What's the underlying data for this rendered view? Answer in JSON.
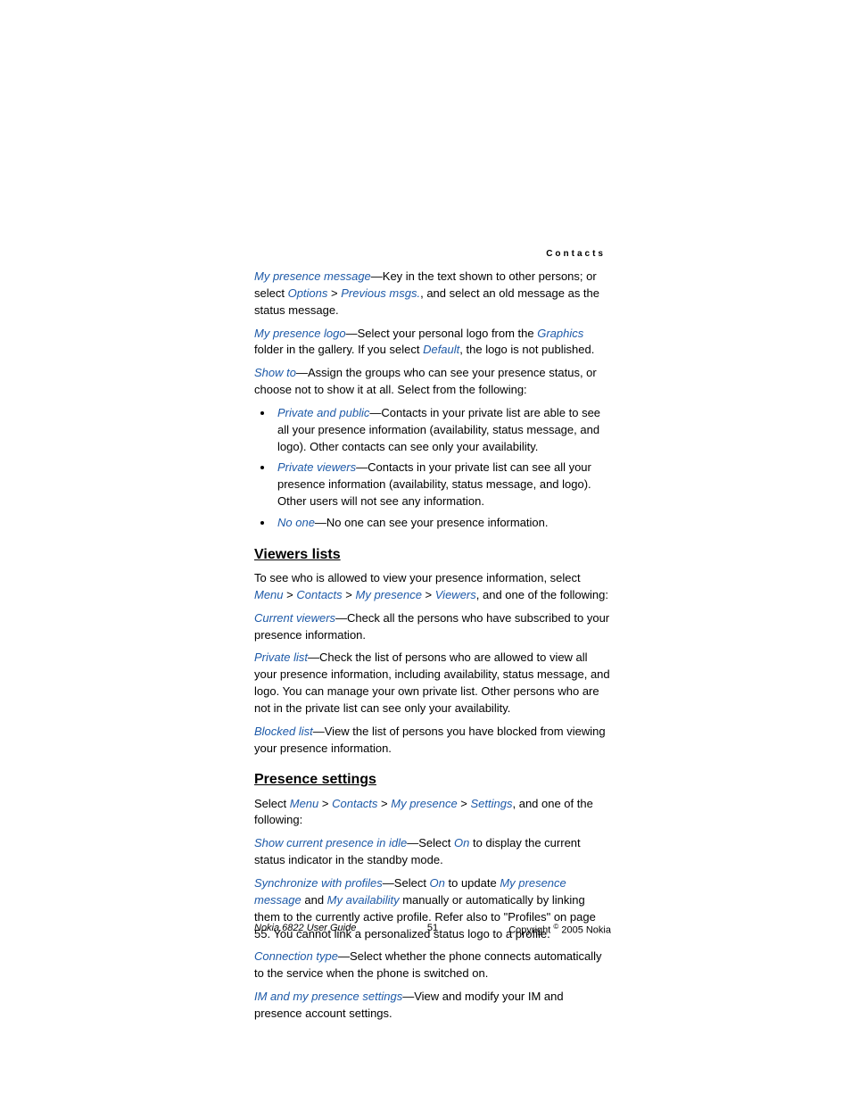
{
  "header": {
    "section_label": "Contacts"
  },
  "p1": {
    "link_msg": "My presence message",
    "t1": "—Key in the text shown to other persons; or select ",
    "link_opt": "Options",
    "t2": " > ",
    "link_prev": "Previous msgs.",
    "t3": ", and select an old message as the status message."
  },
  "p2": {
    "link_logo": "My presence logo",
    "t1": "—Select your personal logo from the ",
    "link_graphics": "Graphics",
    "t2": " folder in the gallery. If you select ",
    "link_default": "Default",
    "t3": ", the logo is not published."
  },
  "p3": {
    "link_showto": "Show to",
    "t1": "—Assign the groups who can see your presence status, or choose not to show it at all. Select from the following:"
  },
  "bullets1": {
    "b1_link": "Private and public",
    "b1_text": "—Contacts in your private list are able to see all your presence information (availability, status message, and logo). Other contacts can see only your availability.",
    "b2_link": "Private viewers",
    "b2_text": "—Contacts in your private list can see all your presence information (availability, status message, and logo). Other users will not see any information.",
    "b3_link": "No one",
    "b3_text": "—No one can see your presence information."
  },
  "h_viewers": "Viewers lists",
  "p4": {
    "t1": "To see who is allowed to view your presence information, select ",
    "link_menu": "Menu",
    "sep": " > ",
    "link_contacts": "Contacts",
    "sep2": " > ",
    "link_mypresence": "My presence",
    "sep3": " > ",
    "link_viewers": "Viewers",
    "t2": ", and one of the following:"
  },
  "p5": {
    "link_cv": "Current viewers",
    "t1": "—Check all the persons who have subscribed to your presence information."
  },
  "p6": {
    "link_pl": "Private list",
    "t1": "—Check the list of persons who are allowed to view all your presence information, including availability, status message, and logo. You can manage your own private list. Other persons who are not in the private list can see only your availability."
  },
  "p7": {
    "link_bl": "Blocked list",
    "t1": "—View the list of persons you have blocked from viewing your presence information."
  },
  "h_presence": "Presence settings",
  "p8": {
    "t1": "Select ",
    "link_menu": "Menu",
    "sep": " > ",
    "link_contacts": "Contacts",
    "sep2": " > ",
    "link_mypresence": "My presence",
    "sep3": " > ",
    "link_settings": "Settings",
    "t2": ", and one of the following:"
  },
  "p9": {
    "link_scpi": "Show current presence in idle",
    "t1": "—Select ",
    "link_on": "On",
    "t2": " to display the current status indicator in the standby mode."
  },
  "p10": {
    "link_swp": "Synchronize with profiles",
    "t1": "—Select ",
    "link_on": "On",
    "t2": " to update ",
    "link_mpm": "My presence message",
    "t3": " and ",
    "link_ma": "My availability",
    "t4": " manually or automatically by linking them to the currently active profile. Refer also to \"Profiles\" on page 55. You cannot link a personalized status logo to a profile."
  },
  "p11": {
    "link_ct": "Connection type",
    "t1": "—Select whether the phone connects automatically to the service when the phone is switched on."
  },
  "p12": {
    "link_imps": "IM and my presence settings",
    "t1": "—View and modify your IM and presence account settings."
  },
  "footer": {
    "left": "Nokia 6822 User Guide",
    "center": "51",
    "right_pre": "Copyright ",
    "right_sup": "©",
    "right_post": " 2005 Nokia"
  }
}
